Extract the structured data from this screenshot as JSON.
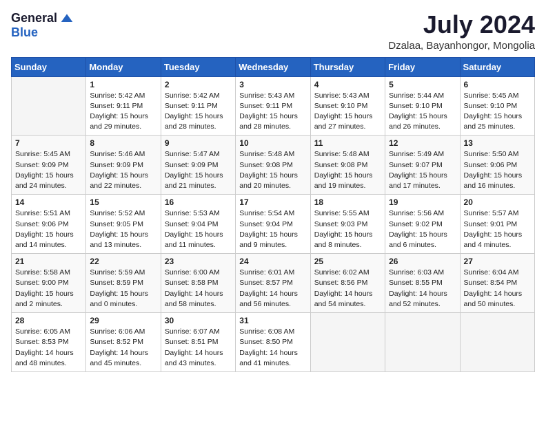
{
  "logo": {
    "general": "General",
    "blue": "Blue"
  },
  "title": {
    "month_year": "July 2024",
    "location": "Dzalaa, Bayanhongor, Mongolia"
  },
  "weekdays": [
    "Sunday",
    "Monday",
    "Tuesday",
    "Wednesday",
    "Thursday",
    "Friday",
    "Saturday"
  ],
  "weeks": [
    [
      {
        "day": "",
        "info": ""
      },
      {
        "day": "1",
        "info": "Sunrise: 5:42 AM\nSunset: 9:11 PM\nDaylight: 15 hours\nand 29 minutes."
      },
      {
        "day": "2",
        "info": "Sunrise: 5:42 AM\nSunset: 9:11 PM\nDaylight: 15 hours\nand 28 minutes."
      },
      {
        "day": "3",
        "info": "Sunrise: 5:43 AM\nSunset: 9:11 PM\nDaylight: 15 hours\nand 28 minutes."
      },
      {
        "day": "4",
        "info": "Sunrise: 5:43 AM\nSunset: 9:10 PM\nDaylight: 15 hours\nand 27 minutes."
      },
      {
        "day": "5",
        "info": "Sunrise: 5:44 AM\nSunset: 9:10 PM\nDaylight: 15 hours\nand 26 minutes."
      },
      {
        "day": "6",
        "info": "Sunrise: 5:45 AM\nSunset: 9:10 PM\nDaylight: 15 hours\nand 25 minutes."
      }
    ],
    [
      {
        "day": "7",
        "info": "Sunrise: 5:45 AM\nSunset: 9:09 PM\nDaylight: 15 hours\nand 24 minutes."
      },
      {
        "day": "8",
        "info": "Sunrise: 5:46 AM\nSunset: 9:09 PM\nDaylight: 15 hours\nand 22 minutes."
      },
      {
        "day": "9",
        "info": "Sunrise: 5:47 AM\nSunset: 9:09 PM\nDaylight: 15 hours\nand 21 minutes."
      },
      {
        "day": "10",
        "info": "Sunrise: 5:48 AM\nSunset: 9:08 PM\nDaylight: 15 hours\nand 20 minutes."
      },
      {
        "day": "11",
        "info": "Sunrise: 5:48 AM\nSunset: 9:08 PM\nDaylight: 15 hours\nand 19 minutes."
      },
      {
        "day": "12",
        "info": "Sunrise: 5:49 AM\nSunset: 9:07 PM\nDaylight: 15 hours\nand 17 minutes."
      },
      {
        "day": "13",
        "info": "Sunrise: 5:50 AM\nSunset: 9:06 PM\nDaylight: 15 hours\nand 16 minutes."
      }
    ],
    [
      {
        "day": "14",
        "info": "Sunrise: 5:51 AM\nSunset: 9:06 PM\nDaylight: 15 hours\nand 14 minutes."
      },
      {
        "day": "15",
        "info": "Sunrise: 5:52 AM\nSunset: 9:05 PM\nDaylight: 15 hours\nand 13 minutes."
      },
      {
        "day": "16",
        "info": "Sunrise: 5:53 AM\nSunset: 9:04 PM\nDaylight: 15 hours\nand 11 minutes."
      },
      {
        "day": "17",
        "info": "Sunrise: 5:54 AM\nSunset: 9:04 PM\nDaylight: 15 hours\nand 9 minutes."
      },
      {
        "day": "18",
        "info": "Sunrise: 5:55 AM\nSunset: 9:03 PM\nDaylight: 15 hours\nand 8 minutes."
      },
      {
        "day": "19",
        "info": "Sunrise: 5:56 AM\nSunset: 9:02 PM\nDaylight: 15 hours\nand 6 minutes."
      },
      {
        "day": "20",
        "info": "Sunrise: 5:57 AM\nSunset: 9:01 PM\nDaylight: 15 hours\nand 4 minutes."
      }
    ],
    [
      {
        "day": "21",
        "info": "Sunrise: 5:58 AM\nSunset: 9:00 PM\nDaylight: 15 hours\nand 2 minutes."
      },
      {
        "day": "22",
        "info": "Sunrise: 5:59 AM\nSunset: 8:59 PM\nDaylight: 15 hours\nand 0 minutes."
      },
      {
        "day": "23",
        "info": "Sunrise: 6:00 AM\nSunset: 8:58 PM\nDaylight: 14 hours\nand 58 minutes."
      },
      {
        "day": "24",
        "info": "Sunrise: 6:01 AM\nSunset: 8:57 PM\nDaylight: 14 hours\nand 56 minutes."
      },
      {
        "day": "25",
        "info": "Sunrise: 6:02 AM\nSunset: 8:56 PM\nDaylight: 14 hours\nand 54 minutes."
      },
      {
        "day": "26",
        "info": "Sunrise: 6:03 AM\nSunset: 8:55 PM\nDaylight: 14 hours\nand 52 minutes."
      },
      {
        "day": "27",
        "info": "Sunrise: 6:04 AM\nSunset: 8:54 PM\nDaylight: 14 hours\nand 50 minutes."
      }
    ],
    [
      {
        "day": "28",
        "info": "Sunrise: 6:05 AM\nSunset: 8:53 PM\nDaylight: 14 hours\nand 48 minutes."
      },
      {
        "day": "29",
        "info": "Sunrise: 6:06 AM\nSunset: 8:52 PM\nDaylight: 14 hours\nand 45 minutes."
      },
      {
        "day": "30",
        "info": "Sunrise: 6:07 AM\nSunset: 8:51 PM\nDaylight: 14 hours\nand 43 minutes."
      },
      {
        "day": "31",
        "info": "Sunrise: 6:08 AM\nSunset: 8:50 PM\nDaylight: 14 hours\nand 41 minutes."
      },
      {
        "day": "",
        "info": ""
      },
      {
        "day": "",
        "info": ""
      },
      {
        "day": "",
        "info": ""
      }
    ]
  ]
}
